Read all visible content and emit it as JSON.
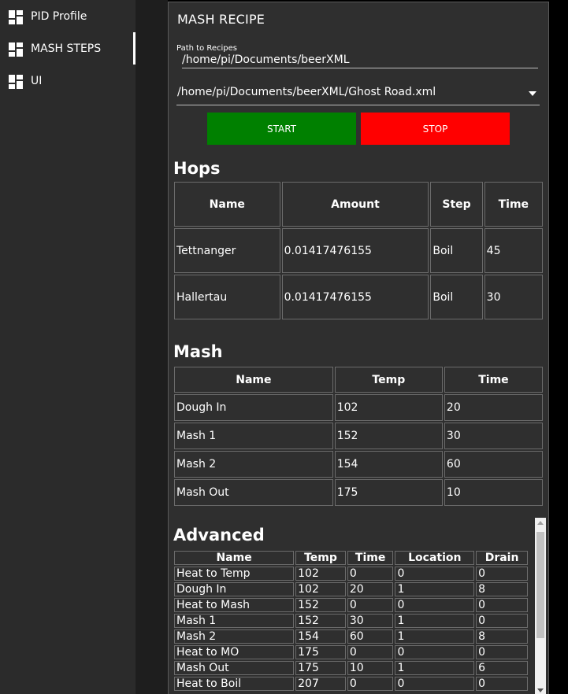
{
  "sidebar": {
    "items": [
      {
        "label": "PID Profile",
        "icon": "dashboard-grid-icon",
        "active": false
      },
      {
        "label": "MASH STEPS",
        "icon": "dashboard-grid-icon",
        "active": true
      },
      {
        "label": "UI",
        "icon": "dashboard-grid-icon",
        "active": false
      }
    ]
  },
  "panel": {
    "title": "MASH RECIPE",
    "path_label": "Path to Recipes",
    "path_value": "/home/pi/Documents/beerXML",
    "recipe_selected": "/home/pi/Documents/beerXML/Ghost Road.xml",
    "start_label": "START",
    "stop_label": "STOP"
  },
  "colors": {
    "start": "#008000",
    "stop": "#ff0000",
    "panel_bg": "#2f2f2f",
    "sidebar_bg": "#2b2b2b"
  },
  "hops": {
    "title": "Hops",
    "headers": [
      "Name",
      "Amount",
      "Step",
      "Time"
    ],
    "rows": [
      [
        "Tettnanger",
        "0.01417476155",
        "Boil",
        "45"
      ],
      [
        "Hallertau",
        "0.01417476155",
        "Boil",
        "30"
      ]
    ]
  },
  "mash": {
    "title": "Mash",
    "headers": [
      "Name",
      "Temp",
      "Time"
    ],
    "rows": [
      [
        "Dough In",
        "102",
        "20"
      ],
      [
        "Mash 1",
        "152",
        "30"
      ],
      [
        "Mash 2",
        "154",
        "60"
      ],
      [
        "Mash Out",
        "175",
        "10"
      ]
    ]
  },
  "advanced": {
    "title": "Advanced",
    "headers": [
      "Name",
      "Temp",
      "Time",
      "Location",
      "Drain"
    ],
    "rows": [
      [
        "Heat to Temp",
        "102",
        "0",
        "0",
        "0"
      ],
      [
        "Dough In",
        "102",
        "20",
        "1",
        "8"
      ],
      [
        "Heat to Mash",
        "152",
        "0",
        "0",
        "0"
      ],
      [
        "Mash 1",
        "152",
        "30",
        "1",
        "0"
      ],
      [
        "Mash 2",
        "154",
        "60",
        "1",
        "8"
      ],
      [
        "Heat to MO",
        "175",
        "0",
        "0",
        "0"
      ],
      [
        "Mash Out",
        "175",
        "10",
        "1",
        "6"
      ],
      [
        "Heat to Boil",
        "207",
        "0",
        "0",
        "0"
      ]
    ]
  }
}
